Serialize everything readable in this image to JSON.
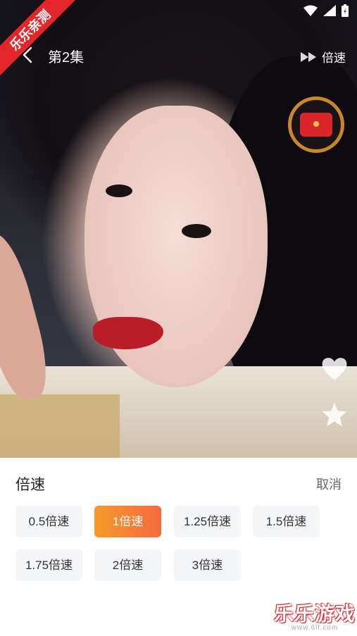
{
  "badge": {
    "text": "乐乐亲测"
  },
  "status_icons": [
    "wifi-icon",
    "signal-icon",
    "battery-icon"
  ],
  "header": {
    "title": "第2集",
    "speed_label": "倍速"
  },
  "speed_panel": {
    "title": "倍速",
    "cancel_label": "取消",
    "options": [
      "0.5倍速",
      "1倍速",
      "1.25倍速",
      "1.5倍速",
      "1.75倍速",
      "2倍速",
      "3倍速"
    ],
    "selected": "1倍速"
  },
  "watermark": {
    "brand": "乐乐游戏",
    "url": "www.6ll.com"
  },
  "colors": {
    "accent_start": "#f59a2a",
    "accent_end": "#f56a3f",
    "badge": "#e2262b"
  }
}
